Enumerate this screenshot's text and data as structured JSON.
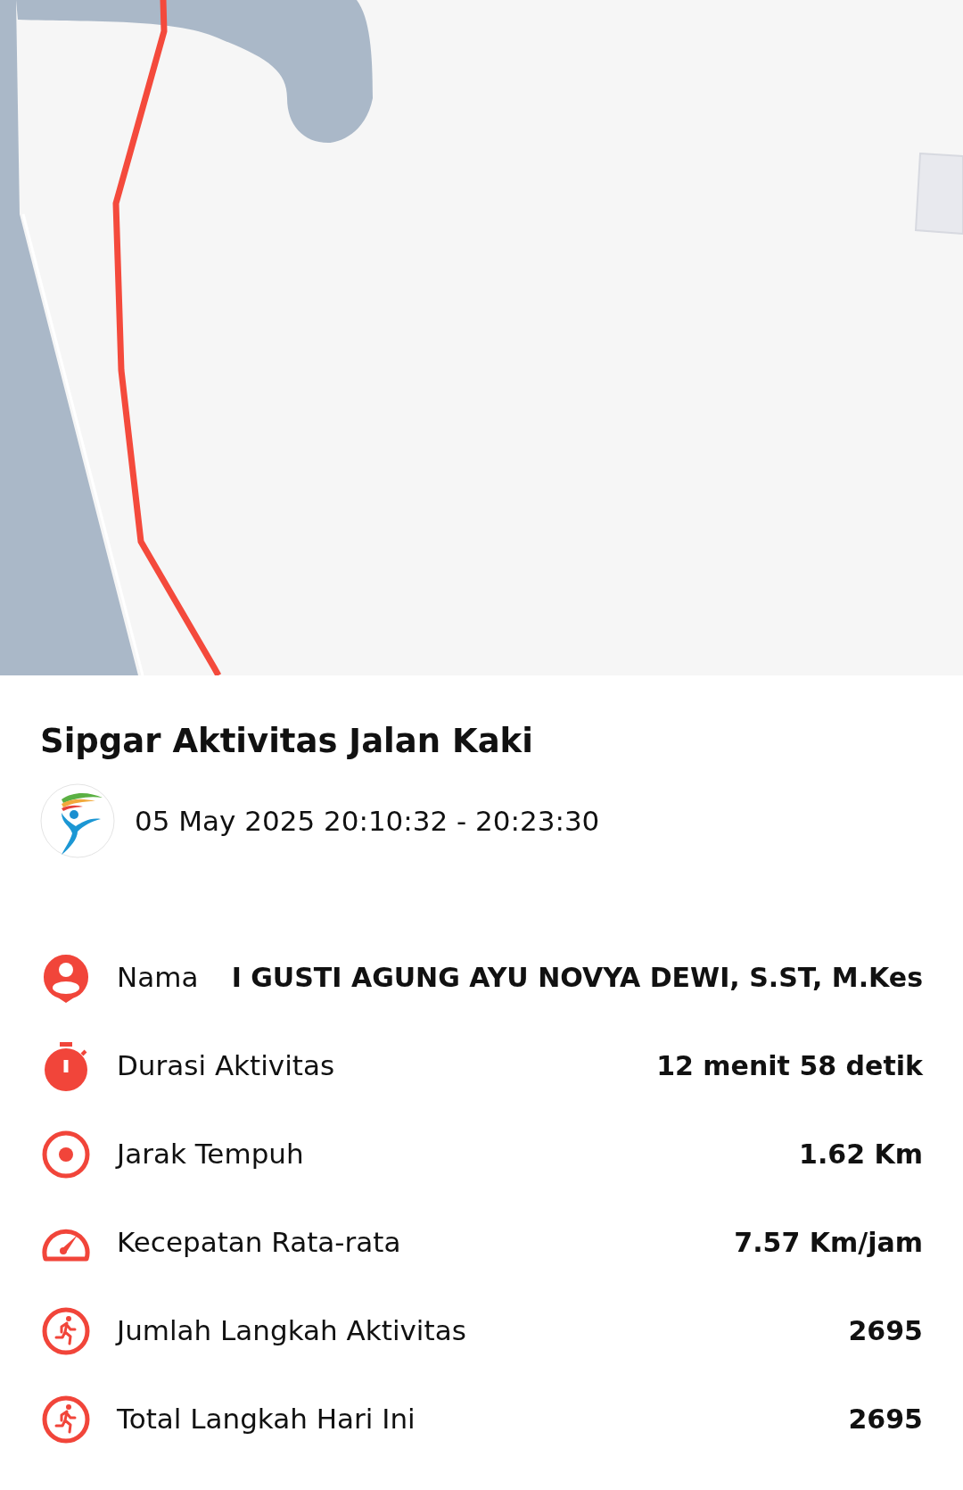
{
  "title": "Sipgar Aktivitas Jalan Kaki",
  "date_range": "05 May 2025 20:10:32 - 20:23:30",
  "stats": [
    {
      "kind": "person",
      "label": "Nama",
      "value": "I GUSTI AGUNG AYU NOVYA DEWI, S.ST, M.Kes"
    },
    {
      "kind": "stopwatch",
      "label": "Durasi Aktivitas",
      "value": "12 menit 58 detik"
    },
    {
      "kind": "target",
      "label": "Jarak Tempuh",
      "value": "1.62 Km"
    },
    {
      "kind": "gauge",
      "label": "Kecepatan Rata-rata",
      "value": "7.57 Km/jam"
    },
    {
      "kind": "run",
      "label": "Jumlah Langkah Aktivitas",
      "value": "2695"
    },
    {
      "kind": "run",
      "label": "Total Langkah Hari Ini",
      "value": "2695"
    }
  ]
}
